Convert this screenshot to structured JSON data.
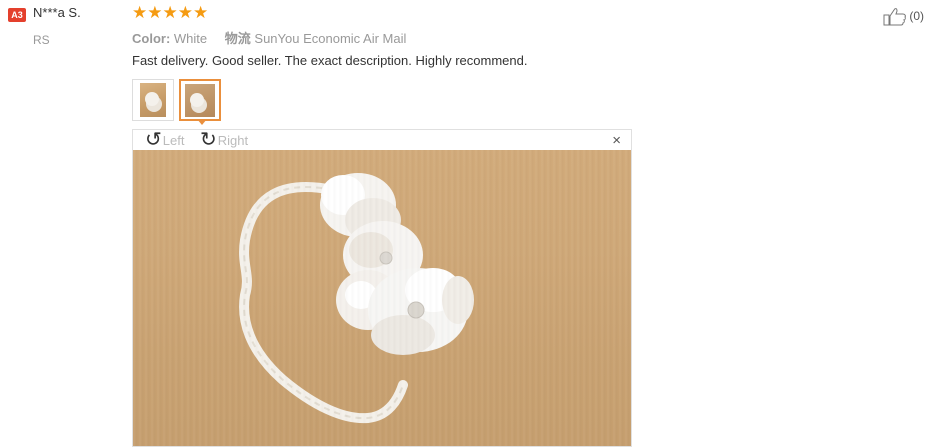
{
  "reviewer": {
    "badge": "A3",
    "name": "N***a S.",
    "country": "RS"
  },
  "rating": {
    "stars": 5,
    "max": 5,
    "star_glyphs": "★★★★★",
    "color": "#f59b12"
  },
  "attributes": {
    "color_label": "Color:",
    "color_value": "White",
    "shipping_label": "物流",
    "shipping_value": "SunYou Economic Air Mail"
  },
  "review_text": "Fast delivery. Good seller. The exact description. Highly recommend.",
  "thumbnails": [
    {
      "name": "photo-1"
    },
    {
      "name": "photo-2",
      "active": true
    }
  ],
  "viewer": {
    "rotate_left_label": "Left",
    "rotate_right_label": "Right",
    "rotate_left_icon": "rotate-ccw-icon",
    "rotate_right_icon": "rotate-cw-icon",
    "close_glyph": "×"
  },
  "helpful": {
    "icon": "thumbs-up-icon",
    "count_label": "(0)"
  },
  "colors": {
    "badge": "#e4402d",
    "accent": "#ea8f3c",
    "muted": "#999999"
  }
}
